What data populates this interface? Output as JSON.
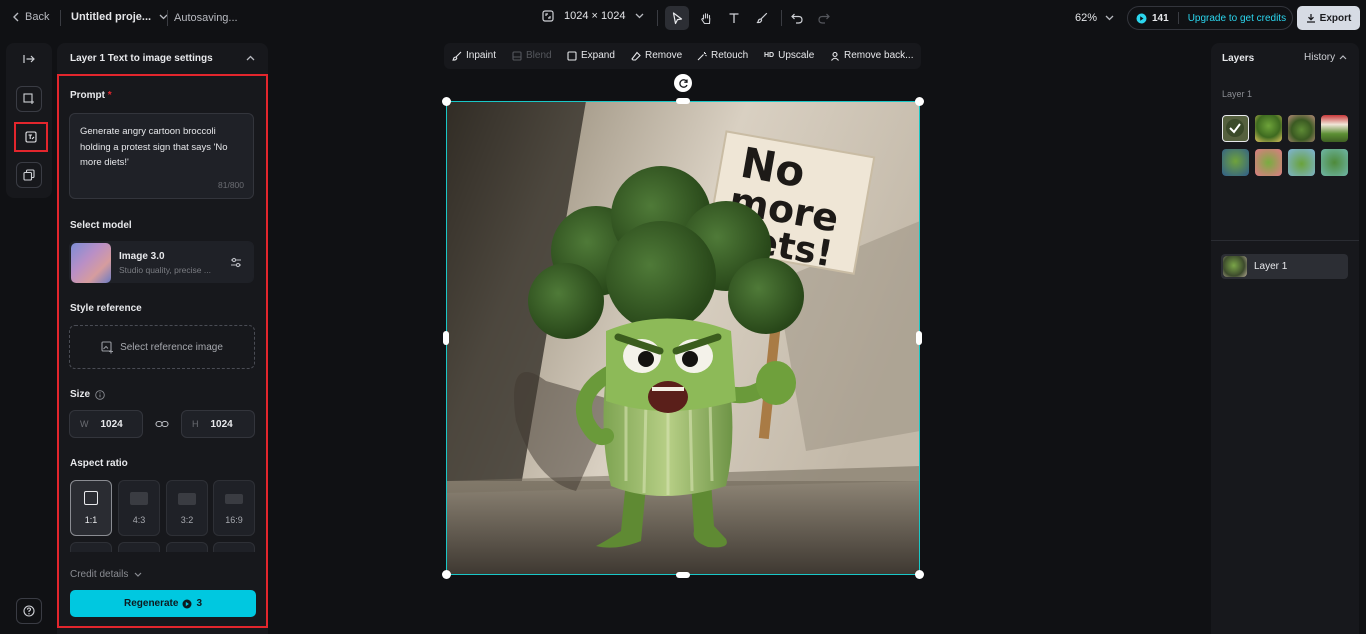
{
  "topbar": {
    "back_label": "Back",
    "project_name": "Untitled proje...",
    "autosave": "Autosaving...",
    "canvas_size": "1024 × 1024",
    "zoom": "62%",
    "credits": "141",
    "upgrade_label": "Upgrade to get credits",
    "export_label": "Export"
  },
  "panel": {
    "title": "Layer 1 Text to image settings",
    "prompt_label": "Prompt",
    "required_mark": "*",
    "prompt_text": "Generate angry cartoon broccoli holding a protest sign that says 'No more diets!'",
    "prompt_count": "81/800",
    "model_label": "Select model",
    "model_name": "Image 3.0",
    "model_desc": "Studio quality, precise ...",
    "style_label": "Style reference",
    "style_button": "Select reference image",
    "size_label": "Size",
    "width_prefix": "W",
    "width_value": "1024",
    "height_prefix": "H",
    "height_value": "1024",
    "aspect_label": "Aspect ratio",
    "ratios": [
      "1:1",
      "4:3",
      "3:2",
      "16:9"
    ],
    "selected_ratio": "1:1",
    "credit_details": "Credit details",
    "regenerate_label": "Regenerate",
    "regenerate_cost": "3"
  },
  "canvas_toolbar": {
    "items": [
      "Inpaint",
      "Blend",
      "Expand",
      "Remove",
      "Retouch",
      "Upscale",
      "Remove back..."
    ],
    "upscale_prefix": "HD",
    "disabled": [
      "Blend"
    ]
  },
  "canvas": {
    "sign_text_lines": [
      "No",
      "more",
      "diets!"
    ]
  },
  "layers_panel": {
    "title": "Layers",
    "history_label": "History",
    "group_label": "Layer 1",
    "layer_item_label": "Layer 1"
  },
  "colors": {
    "accent": "#00c8e0",
    "selection_outline": "#e3262d",
    "canvas_frame": "#19c7c7",
    "panel_bg": "#17181c",
    "page_bg": "#101114"
  }
}
